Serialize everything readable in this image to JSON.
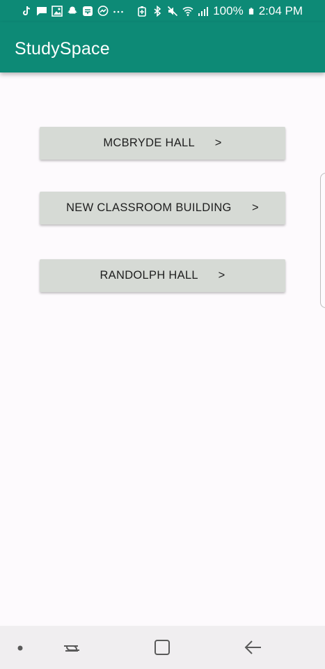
{
  "status_bar": {
    "battery_percent": "100%",
    "time": "2:04 PM",
    "left_icons": [
      "tiktok-icon",
      "message-icon",
      "gallery-icon",
      "snapchat-icon",
      "inbox-icon",
      "messenger-icon",
      "more-dots-icon"
    ],
    "right_icons": [
      "battery-saver-icon",
      "bluetooth-icon",
      "mute-icon",
      "wifi-icon",
      "signal-icon",
      "battery-icon"
    ]
  },
  "app_bar": {
    "title": "StudySpace",
    "color": "#0d8a76"
  },
  "buildings": [
    {
      "label": "MCBRYDE HALL      >"
    },
    {
      "label": "NEW CLASSROOM BUILDING      >"
    },
    {
      "label": "RANDOLPH HALL      >"
    }
  ],
  "nav_bar": {
    "items": [
      "dot-indicator",
      "recent-apps-icon",
      "home-icon",
      "back-icon"
    ]
  },
  "colors": {
    "button_background": "#d6dad5",
    "page_background": "#fdfafd"
  }
}
